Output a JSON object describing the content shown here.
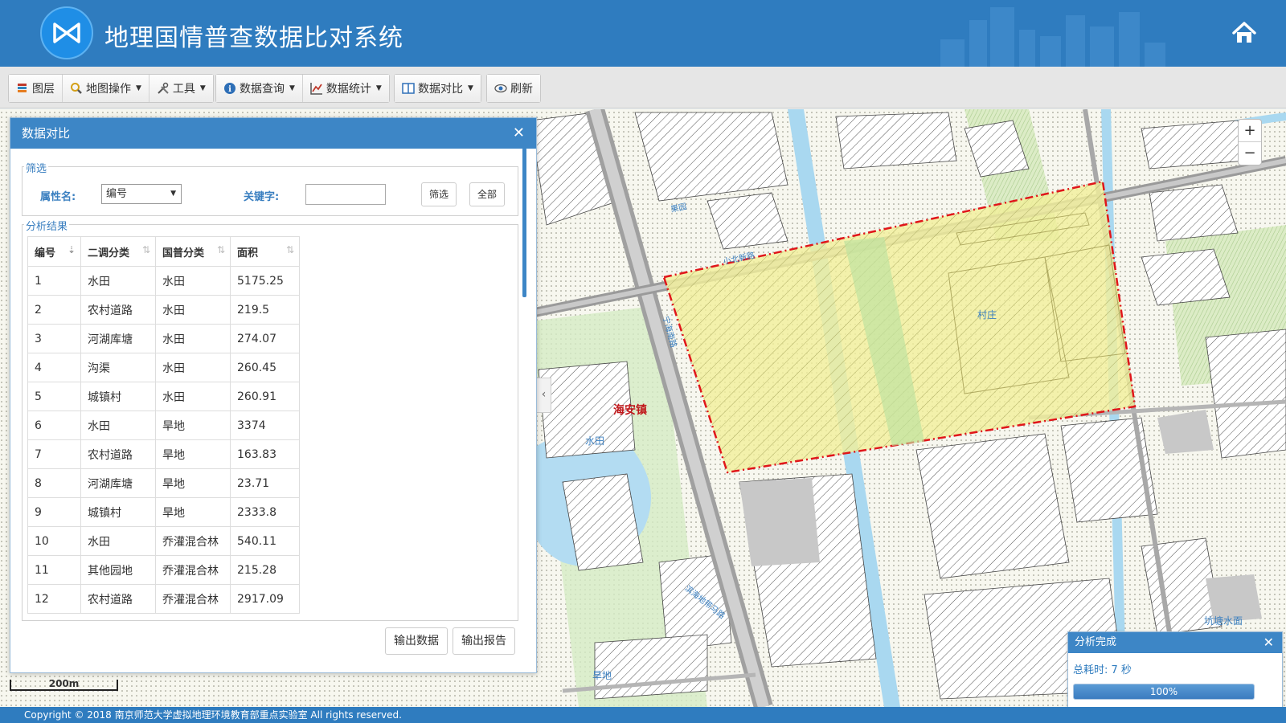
{
  "header": {
    "title": "地理国情普查数据比对系统",
    "logo_icon": "bowtie-logo-icon",
    "home_icon": "home-icon"
  },
  "toolbar": {
    "items": [
      {
        "label": "图层",
        "icon": "layers-icon",
        "dropdown": false
      },
      {
        "label": "地图操作",
        "icon": "magnifier-icon",
        "dropdown": true
      },
      {
        "label": "工具",
        "icon": "tools-icon",
        "dropdown": true
      },
      {
        "label": "数据查询",
        "icon": "info-icon",
        "dropdown": true
      },
      {
        "label": "数据统计",
        "icon": "chart-icon",
        "dropdown": true
      },
      {
        "label": "数据对比",
        "icon": "compare-icon",
        "dropdown": true
      },
      {
        "label": "刷新",
        "icon": "eye-icon",
        "dropdown": false
      }
    ]
  },
  "panel": {
    "title": "数据对比",
    "filter": {
      "legend": "筛选",
      "attr_label": "属性名:",
      "attr_value": "编号",
      "keyword_label": "关键字:",
      "keyword_value": "",
      "filter_btn": "筛选",
      "all_btn": "全部"
    },
    "results": {
      "legend": "分析结果",
      "columns": [
        "编号",
        "二调分类",
        "国普分类",
        "面积"
      ],
      "rows": [
        [
          "1",
          "水田",
          "水田",
          "5175.25"
        ],
        [
          "2",
          "农村道路",
          "水田",
          "219.5"
        ],
        [
          "3",
          "河湖库塘",
          "水田",
          "274.07"
        ],
        [
          "4",
          "沟渠",
          "水田",
          "260.45"
        ],
        [
          "5",
          "城镇村",
          "水田",
          "260.91"
        ],
        [
          "6",
          "水田",
          "旱地",
          "3374"
        ],
        [
          "7",
          "农村道路",
          "旱地",
          "163.83"
        ],
        [
          "8",
          "河湖库塘",
          "旱地",
          "23.71"
        ],
        [
          "9",
          "城镇村",
          "旱地",
          "2333.8"
        ],
        [
          "10",
          "水田",
          "乔灌混合林",
          "540.11"
        ],
        [
          "11",
          "其他园地",
          "乔灌混合林",
          "215.28"
        ],
        [
          "12",
          "农村道路",
          "乔灌混合林",
          "2917.09"
        ]
      ]
    },
    "export_data_btn": "输出数据",
    "export_report_btn": "输出报告"
  },
  "map": {
    "labels": {
      "town": "海安镇",
      "village": "村庄",
      "paddy": "水田",
      "dryland": "旱地",
      "pond": "坑塘水面",
      "road1": "果园",
      "road2": "宁海南路",
      "road3": "宁海南路",
      "road4": "滨海地带马路",
      "lane": "小北新路"
    },
    "scale_label": "200m",
    "zoom_in": "+",
    "zoom_out": "−",
    "collapse": "‹"
  },
  "analysis": {
    "title": "分析完成",
    "elapsed": "总耗时: 7 秒",
    "progress_pct": 100,
    "progress_text": "100%"
  },
  "footer": {
    "text": "Copyright © 2018 南京师范大学虚拟地理环境教育部重点实验室 All rights reserved."
  },
  "colors": {
    "header": "#2f7cbf",
    "accent": "#3d86c6",
    "highlight": "#f2f08a",
    "boundary": "#e0161a"
  }
}
